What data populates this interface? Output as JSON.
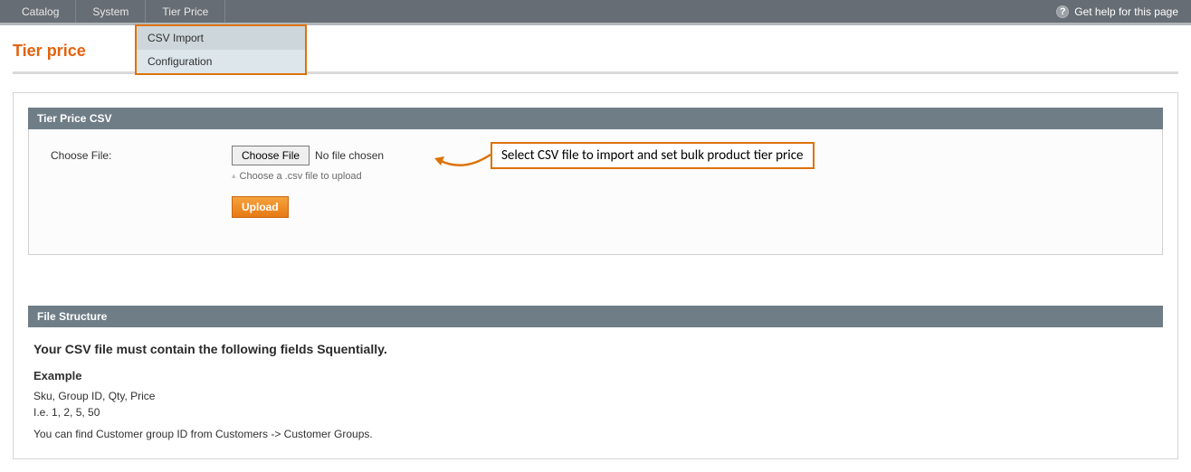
{
  "nav": {
    "items": [
      "Catalog",
      "System",
      "Tier Price"
    ],
    "help": "Get help for this page",
    "submenu": {
      "csv_import": "CSV Import",
      "configuration": "Configuration"
    }
  },
  "page_title": "Tier price",
  "panel1": {
    "head": "Tier Price CSV",
    "choose_label": "Choose File:",
    "choose_btn": "Choose File",
    "no_file": "No file chosen",
    "hint": "Choose a .csv file to upload",
    "upload": "Upload"
  },
  "annotation": "Select CSV file to import and set bulk product tier price",
  "panel2": {
    "head": "File Structure",
    "lead": "Your CSV file must contain the following fields Squentially.",
    "example_head": "Example",
    "line1": "Sku, Group ID, Qty, Price",
    "line2": "I.e. 1, 2, 5, 50",
    "note": "You can find Customer group ID from Customers -> Customer Groups."
  }
}
